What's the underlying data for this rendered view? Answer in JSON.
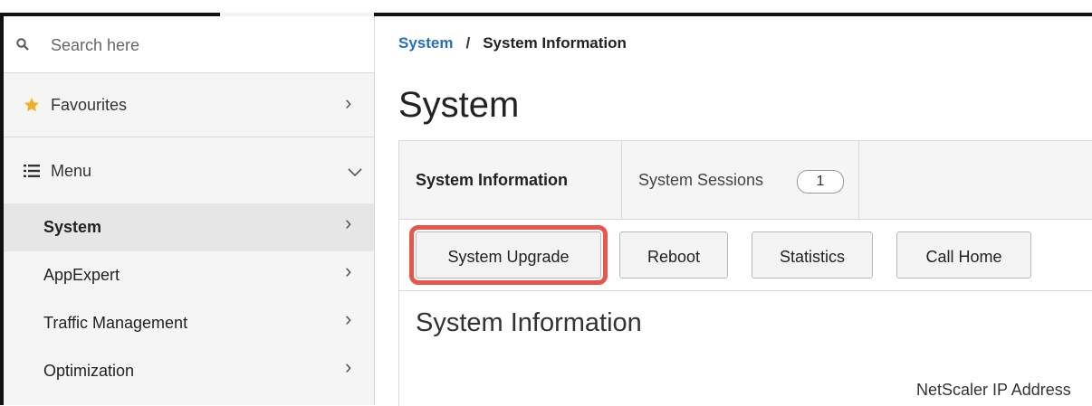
{
  "search": {
    "placeholder": "Search here",
    "icon": "search-icon"
  },
  "sidebar": {
    "favourites_label": "Favourites",
    "menu_label": "Menu",
    "items": [
      {
        "label": "System",
        "active": true
      },
      {
        "label": "AppExpert"
      },
      {
        "label": "Traffic Management"
      },
      {
        "label": "Optimization"
      }
    ]
  },
  "breadcrumb": {
    "root": "System",
    "separator": "/",
    "current": "System Information"
  },
  "page": {
    "title": "System"
  },
  "tabs": [
    {
      "label": "System Information",
      "active": true
    },
    {
      "label": "System Sessions",
      "count": "1"
    }
  ],
  "toolbar": {
    "buttons": [
      {
        "label": "System Upgrade",
        "highlighted": true
      },
      {
        "label": "Reboot"
      },
      {
        "label": "Statistics"
      },
      {
        "label": "Call Home"
      }
    ]
  },
  "section": {
    "title": "System Information",
    "field_label": "NetScaler IP Address"
  },
  "colors": {
    "link": "#2a6ebb",
    "highlight": "#e5574a",
    "star": "#f2b01e",
    "sidebar_bg": "#f5f5f5",
    "active_bg": "#e6e6e6"
  }
}
